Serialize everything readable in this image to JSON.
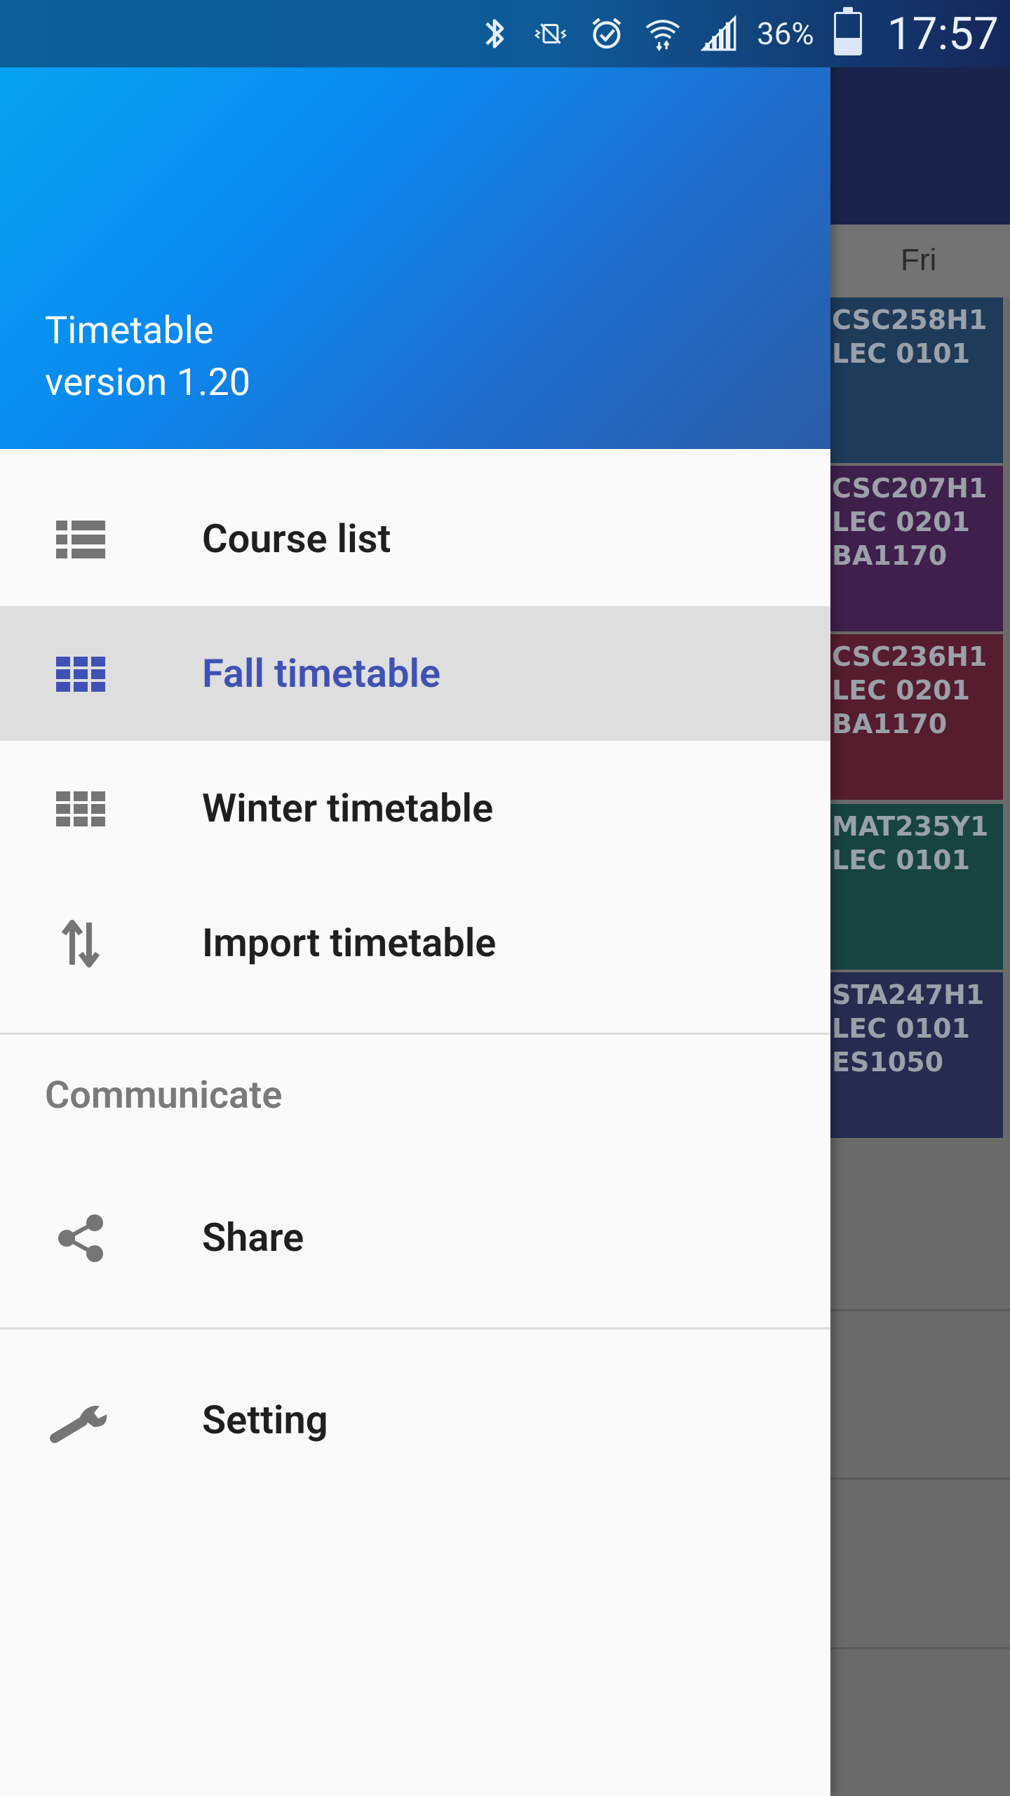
{
  "status_bar": {
    "battery_percent": "36%",
    "time": "17:57",
    "icons": [
      "bluetooth-icon",
      "vibrate-icon",
      "alarm-icon",
      "wifi-icon",
      "signal-icon",
      "battery-icon"
    ]
  },
  "background_app": {
    "day_header": "Fri",
    "courses": [
      {
        "lines": [
          "CSC258H1",
          "LEC 0101"
        ],
        "color": "#1f3b5a"
      },
      {
        "lines": [
          "CSC207H1",
          "LEC 0201",
          "BA1170"
        ],
        "color": "#3f1f4b"
      },
      {
        "lines": [
          "CSC236H1",
          "LEC 0201",
          "BA1170"
        ],
        "color": "#551d2e"
      },
      {
        "lines": [
          "MAT235Y1",
          "LEC 0101"
        ],
        "color": "#17443f"
      },
      {
        "lines": [
          "STA247H1",
          "LEC 0101",
          "ES1050"
        ],
        "color": "#262b50"
      }
    ]
  },
  "drawer": {
    "app_name": "Timetable",
    "version": "version 1.20",
    "menu": [
      {
        "label": "Course list",
        "icon": "list-icon"
      },
      {
        "label": "Fall timetable",
        "icon": "grid-icon",
        "selected": true
      },
      {
        "label": "Winter timetable",
        "icon": "grid-icon"
      },
      {
        "label": "Import timetable",
        "icon": "import-export-icon"
      }
    ],
    "section_title": "Communicate",
    "share_label": "Share",
    "setting_label": "Setting",
    "accent_color": "#3f51b5"
  }
}
